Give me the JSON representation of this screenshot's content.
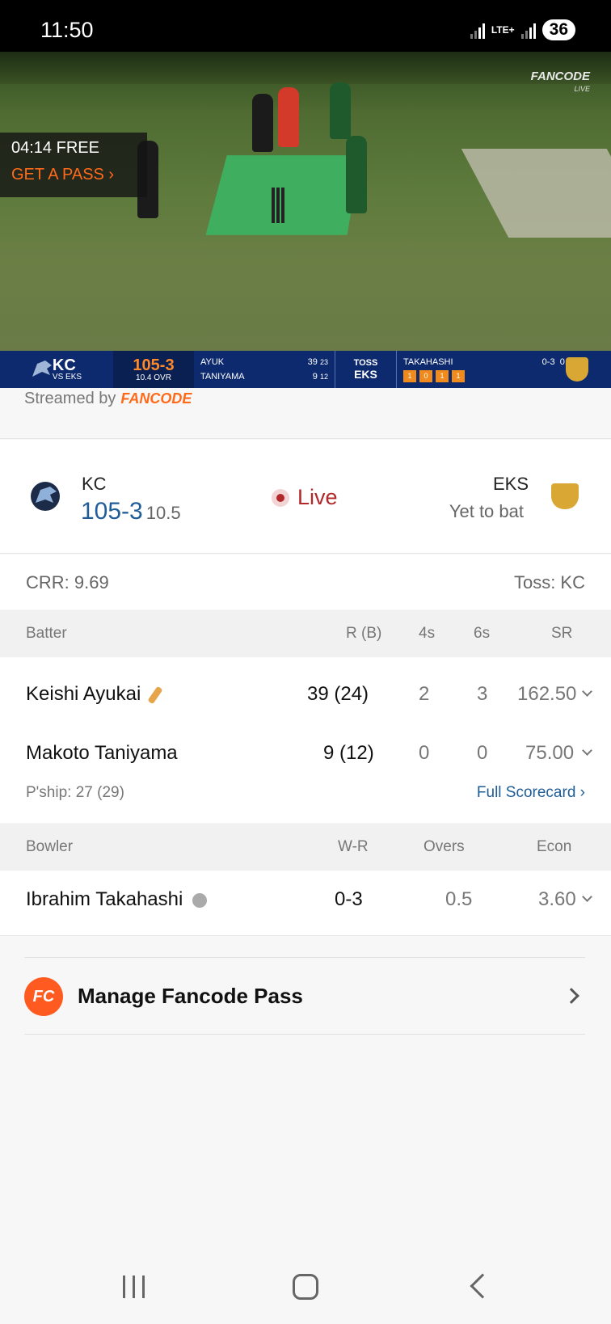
{
  "status_bar": {
    "time": "11:50",
    "network": "LTE+",
    "battery": "36"
  },
  "video": {
    "watermark": "FANCODE",
    "watermark_sub": "LIVE",
    "free_timer": "04:14 FREE",
    "get_pass": "GET A PASS ›"
  },
  "score_bar": {
    "team": "KC",
    "vs": "VS EKS",
    "score": "105-3",
    "overs": "10.4 OVR",
    "batter1_name": "AYUK",
    "batter1_runs": "39",
    "batter1_balls": "23",
    "batter2_name": "TANIYAMA",
    "batter2_runs": "9",
    "batter2_balls": "12",
    "toss_label": "TOSS",
    "toss_team": "EKS",
    "bowler_name": "TAKAHASHI",
    "bowler_figures": "0-3",
    "bowler_overs": "0.4",
    "balls": [
      "1",
      "0",
      "1",
      "1"
    ]
  },
  "streamed_by": {
    "label": "Streamed by",
    "brand": "FANCODE"
  },
  "match": {
    "team1": "KC",
    "team1_score": "105-3",
    "team1_overs": "10.5",
    "status": "Live",
    "team2": "EKS",
    "team2_status": "Yet to bat"
  },
  "meta": {
    "crr": "CRR: 9.69",
    "toss": "Toss: KC"
  },
  "batting": {
    "headers": [
      "Batter",
      "R (B)",
      "4s",
      "6s",
      "SR"
    ],
    "rows": [
      {
        "name": "Keishi Ayukai",
        "rb": "39 (24)",
        "fours": "2",
        "sixes": "3",
        "sr": "162.50"
      },
      {
        "name": "Makoto Taniyama",
        "rb": "9 (12)",
        "fours": "0",
        "sixes": "0",
        "sr": "75.00"
      }
    ],
    "partnership": "P'ship: 27 (29)",
    "full_scorecard": "Full Scorecard ›"
  },
  "bowling": {
    "headers": [
      "Bowler",
      "W-R",
      "Overs",
      "Econ"
    ],
    "rows": [
      {
        "name": "Ibrahim Takahashi",
        "wr": "0-3",
        "overs": "0.5",
        "econ": "3.60"
      }
    ]
  },
  "manage_pass": {
    "icon": "FC",
    "label": "Manage Fancode Pass"
  }
}
